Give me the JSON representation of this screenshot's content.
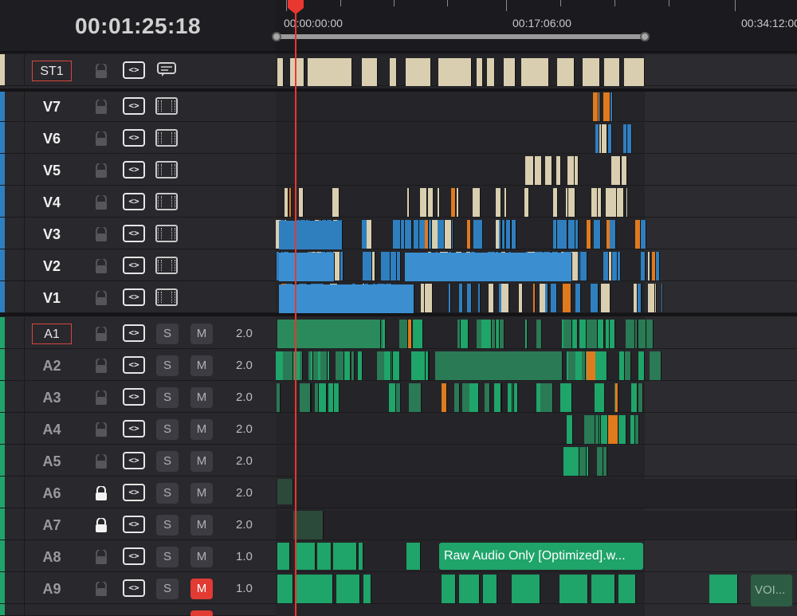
{
  "timecode": "00:01:25:18",
  "ruler": {
    "labels": [
      "00:00:00:00",
      "00:17:06:00",
      "00:34:12:00"
    ]
  },
  "subtitle_track": {
    "name": "ST1"
  },
  "video_tracks": [
    {
      "name": "V7"
    },
    {
      "name": "V6"
    },
    {
      "name": "V5"
    },
    {
      "name": "V4"
    },
    {
      "name": "V3"
    },
    {
      "name": "V2"
    },
    {
      "name": "V1"
    }
  ],
  "audio_tracks": [
    {
      "name": "A1",
      "locked": false,
      "mute": false,
      "level": "2.0"
    },
    {
      "name": "A2",
      "locked": false,
      "mute": false,
      "level": "2.0"
    },
    {
      "name": "A3",
      "locked": false,
      "mute": false,
      "level": "2.0"
    },
    {
      "name": "A4",
      "locked": false,
      "mute": false,
      "level": "2.0"
    },
    {
      "name": "A5",
      "locked": false,
      "mute": false,
      "level": "2.0"
    },
    {
      "name": "A6",
      "locked": true,
      "mute": false,
      "level": "2.0"
    },
    {
      "name": "A7",
      "locked": true,
      "mute": false,
      "level": "2.0"
    },
    {
      "name": "A8",
      "locked": false,
      "mute": false,
      "level": "1.0"
    },
    {
      "name": "A9",
      "locked": false,
      "mute": true,
      "level": "1.0"
    }
  ],
  "buttons": {
    "solo": "S",
    "mute": "M",
    "auto_select": "<>"
  },
  "clips": {
    "a8_label": "Raw Audio Only [Optimized].w...",
    "a9_label": "VOI..."
  },
  "colors": {
    "video": "#2f7fbf",
    "audio": "#1fa46a",
    "subtitle": "#d9cfb0",
    "playhead": "#e8372f",
    "marker": "#e07a1f"
  }
}
